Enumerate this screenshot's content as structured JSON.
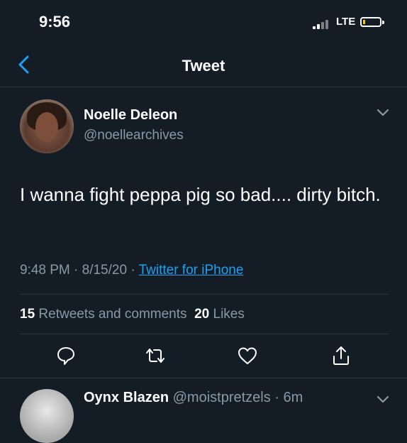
{
  "status_bar": {
    "time": "9:56",
    "network": "LTE"
  },
  "nav": {
    "title": "Tweet"
  },
  "tweet": {
    "author_name": "Noelle Deleon",
    "author_handle": "@noellearchives",
    "text": "I wanna fight peppa pig so bad.... dirty bitch.",
    "timestamp": "9:48 PM · 8/15/20 · ",
    "source": "Twitter for iPhone",
    "retweets_count": "15",
    "retweets_label": "Retweets and comments",
    "likes_count": "20",
    "likes_label": "Likes"
  },
  "actions": [
    "reply-icon",
    "retweet-icon",
    "like-icon",
    "share-icon"
  ],
  "reply": {
    "author_name": "Oynx Blazen",
    "author_handle": "@moistpretzels",
    "time": " · 6m"
  },
  "colors": {
    "background": "#141d26",
    "secondary_text": "#8899a6",
    "accent": "#1da1f2",
    "divider": "#2b3540"
  }
}
